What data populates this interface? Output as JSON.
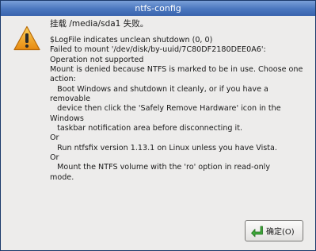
{
  "window": {
    "title": "ntfs-config"
  },
  "dialog": {
    "primary_text": "挂载 /media/sda1 失败。",
    "secondary_text": "$LogFile indicates unclean shutdown (0, 0)\nFailed to mount '/dev/disk/by-uuid/7C80DF2180DEE0A6':\nOperation not supported\nMount is denied because NTFS is marked to be in use. Choose one\naction:\n   Boot Windows and shutdown it cleanly, or if you have a\nremovable\n   device then click the 'Safely Remove Hardware' icon in the\nWindows\n   taskbar notification area before disconnecting it.\nOr\n   Run ntfsfix version 1.13.1 on Linux unless you have Vista.\nOr\n   Mount the NTFS volume with the 'ro' option in read-only\nmode.",
    "ok_label": "确定(O)",
    "icons": {
      "dialog": "warning-icon",
      "ok": "ok-arrow-icon"
    },
    "colors": {
      "warning": "#f0a020",
      "ok_arrow": "#3ea83a",
      "titlebar": "#4a76be"
    }
  }
}
